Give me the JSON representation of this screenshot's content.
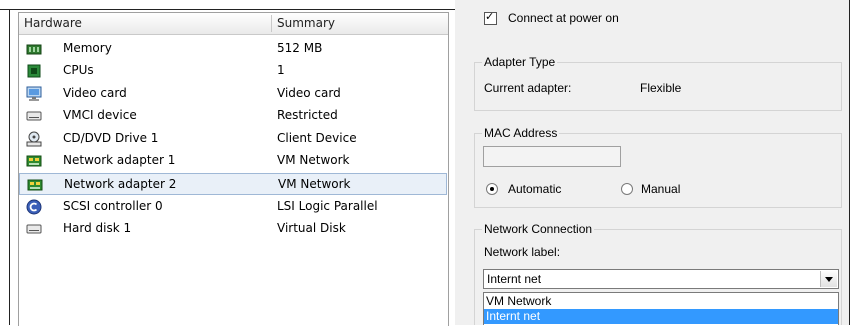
{
  "hardware_list": {
    "columns": {
      "hardware": "Hardware",
      "summary": "Summary"
    },
    "rows": [
      {
        "name": "Memory",
        "summary": "512 MB",
        "icon": "memory-icon",
        "selected": false
      },
      {
        "name": "CPUs",
        "summary": "1",
        "icon": "cpu-icon",
        "selected": false
      },
      {
        "name": "Video card",
        "summary": "Video card",
        "icon": "video-card-icon",
        "selected": false
      },
      {
        "name": "VMCI device",
        "summary": "Restricted",
        "icon": "vmci-device-icon",
        "selected": false
      },
      {
        "name": "CD/DVD Drive 1",
        "summary": "Client Device",
        "icon": "cd-dvd-drive-icon",
        "selected": false
      },
      {
        "name": "Network adapter 1",
        "summary": "VM Network",
        "icon": "network-adapter-icon",
        "selected": false
      },
      {
        "name": "Network adapter 2",
        "summary": "VM Network",
        "icon": "network-adapter-icon",
        "selected": true
      },
      {
        "name": "SCSI controller 0",
        "summary": "LSI Logic Parallel",
        "icon": "scsi-controller-icon",
        "selected": false
      },
      {
        "name": "Hard disk 1",
        "summary": "Virtual Disk",
        "icon": "hard-disk-icon",
        "selected": false
      }
    ]
  },
  "device_status": {
    "connect_at_power_on": "Connect at power on",
    "checked": true
  },
  "adapter_type": {
    "title": "Adapter Type",
    "current_label": "Current adapter:",
    "current_value": "Flexible"
  },
  "mac_address": {
    "title": "MAC Address",
    "value": "",
    "automatic_label": "Automatic",
    "manual_label": "Manual",
    "selected": "Automatic"
  },
  "network_connection": {
    "title": "Network Connection",
    "label": "Network label:",
    "selected_value": "Internt net",
    "options": [
      "VM Network",
      "Internt net"
    ],
    "highlighted": "Internt net"
  },
  "colors": {
    "selection_highlight": "#3399ff",
    "row_selected": "#e9f0f8",
    "panel_bg": "#f0f0f0"
  }
}
